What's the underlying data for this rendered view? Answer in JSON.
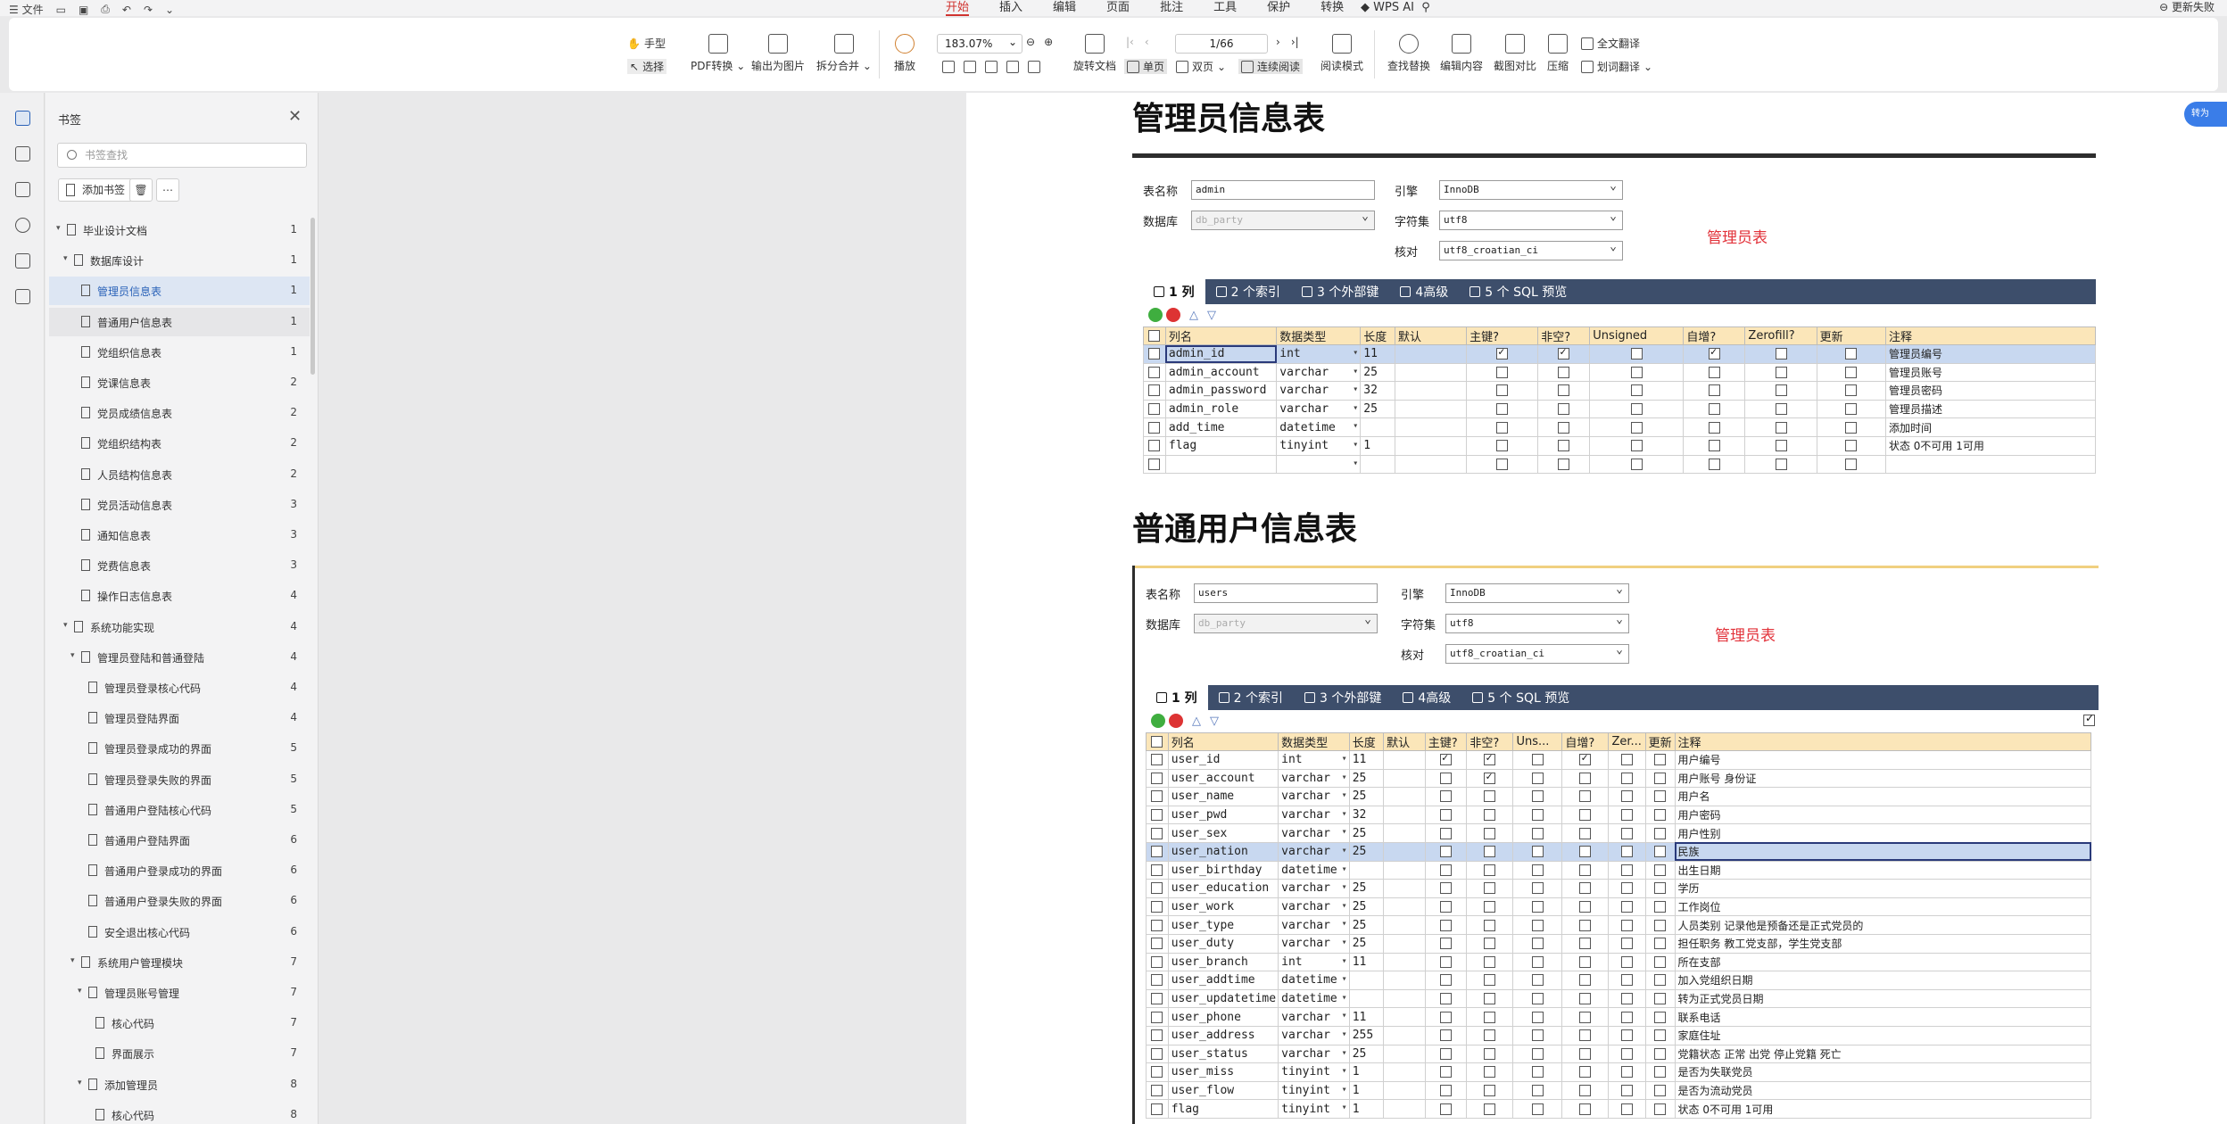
{
  "menubar": {
    "file": "文件",
    "tabs": [
      "开始",
      "插入",
      "编辑",
      "页面",
      "批注",
      "工具",
      "保护",
      "转换"
    ],
    "active_tab": 0,
    "wps_ai": "WPS AI",
    "update": "更新失败"
  },
  "toolbar": {
    "hand": "手型",
    "select": "选择",
    "pdf_convert": "PDF转换",
    "export_image": "输出为图片",
    "split_merge": "拆分合并",
    "play": "播放",
    "zoom": "183.07%",
    "rotate": "旋转文档",
    "single": "单页",
    "double": "双页",
    "continuous": "连续阅读",
    "page": "1/66",
    "read_mode": "阅读模式",
    "find_replace": "查找替换",
    "edit_content": "编辑内容",
    "screenshot_compare": "截图对比",
    "compress": "压缩",
    "full_translate": "全文翻译",
    "word_translate": "划词翻译"
  },
  "panel": {
    "title": "书签",
    "search_placeholder": "书签查找",
    "add_bookmark": "添加书签",
    "items": [
      {
        "label": "毕业设计文档",
        "page": "1",
        "level": 0,
        "arrow": true
      },
      {
        "label": "数据库设计",
        "page": "1",
        "level": 1,
        "arrow": true
      },
      {
        "label": "管理员信息表",
        "page": "1",
        "level": 2,
        "arrow": false,
        "selected": true
      },
      {
        "label": "普通用户信息表",
        "page": "1",
        "level": 2,
        "arrow": false,
        "hover": true
      },
      {
        "label": "党组织信息表",
        "page": "1",
        "level": 2,
        "arrow": false
      },
      {
        "label": "党课信息表",
        "page": "2",
        "level": 2,
        "arrow": false
      },
      {
        "label": "党员成绩信息表",
        "page": "2",
        "level": 2,
        "arrow": false
      },
      {
        "label": "党组织结构表",
        "page": "2",
        "level": 2,
        "arrow": false
      },
      {
        "label": "人员结构信息表",
        "page": "2",
        "level": 2,
        "arrow": false
      },
      {
        "label": "党员活动信息表",
        "page": "3",
        "level": 2,
        "arrow": false
      },
      {
        "label": "通知信息表",
        "page": "3",
        "level": 2,
        "arrow": false
      },
      {
        "label": "党费信息表",
        "page": "3",
        "level": 2,
        "arrow": false
      },
      {
        "label": "操作日志信息表",
        "page": "4",
        "level": 2,
        "arrow": false
      },
      {
        "label": "系统功能实现",
        "page": "4",
        "level": 1,
        "arrow": true
      },
      {
        "label": "管理员登陆和普通登陆",
        "page": "4",
        "level": 2,
        "arrow": true
      },
      {
        "label": "管理员登录核心代码",
        "page": "4",
        "level": 3,
        "arrow": false
      },
      {
        "label": "管理员登陆界面",
        "page": "4",
        "level": 3,
        "arrow": false
      },
      {
        "label": "管理员登录成功的界面",
        "page": "5",
        "level": 3,
        "arrow": false
      },
      {
        "label": "管理员登录失败的界面",
        "page": "5",
        "level": 3,
        "arrow": false
      },
      {
        "label": "普通用户登陆核心代码",
        "page": "5",
        "level": 3,
        "arrow": false
      },
      {
        "label": "普通用户登陆界面",
        "page": "6",
        "level": 3,
        "arrow": false
      },
      {
        "label": "普通用户登录成功的界面",
        "page": "6",
        "level": 3,
        "arrow": false
      },
      {
        "label": "普通用户登录失败的界面",
        "page": "6",
        "level": 3,
        "arrow": false
      },
      {
        "label": "安全退出核心代码",
        "page": "6",
        "level": 3,
        "arrow": false
      },
      {
        "label": "系统用户管理模块",
        "page": "7",
        "level": 2,
        "arrow": true
      },
      {
        "label": "管理员账号管理",
        "page": "7",
        "level": 3,
        "arrow": true
      },
      {
        "label": "核心代码",
        "page": "7",
        "level": 4,
        "arrow": false
      },
      {
        "label": "界面展示",
        "page": "7",
        "level": 4,
        "arrow": false
      },
      {
        "label": "添加管理员",
        "page": "8",
        "level": 3,
        "arrow": true
      },
      {
        "label": "核心代码",
        "page": "8",
        "level": 4,
        "arrow": false
      }
    ]
  },
  "doc": {
    "heading1": "管理员信息表",
    "heading2": "普通用户信息表",
    "labels": {
      "table_name": "表名称",
      "database": "数据库",
      "engine": "引擎",
      "charset": "字符集",
      "collation": "核对"
    },
    "tabs": [
      "1 列",
      "2 个索引",
      "3 个外部键",
      "4高级",
      "5 个 SQL 预览"
    ],
    "admin": {
      "table_name": "admin",
      "database": "db_party",
      "engine": "InnoDB",
      "charset": "utf8",
      "collation": "utf8_croatian_ci",
      "red_label": "管理员表",
      "headers": [
        "列名",
        "数据类型",
        "长度",
        "默认",
        "主键?",
        "非空?",
        "Unsigned",
        "自增?",
        "Zerofill?",
        "更新",
        "注释"
      ],
      "rows": [
        {
          "name": "admin_id",
          "type": "int",
          "len": "11",
          "pk": true,
          "nn": true,
          "ai": true,
          "comment": "管理员编号",
          "hl": true
        },
        {
          "name": "admin_account",
          "type": "varchar",
          "len": "25",
          "pk": false,
          "nn": false,
          "ai": false,
          "comment": "管理员账号"
        },
        {
          "name": "admin_password",
          "type": "varchar",
          "len": "32",
          "pk": false,
          "nn": false,
          "ai": false,
          "comment": "管理员密码"
        },
        {
          "name": "admin_role",
          "type": "varchar",
          "len": "25",
          "pk": false,
          "nn": false,
          "ai": false,
          "comment": "管理员描述"
        },
        {
          "name": "add_time",
          "type": "datetime",
          "len": "",
          "pk": false,
          "nn": false,
          "ai": false,
          "comment": "添加时间"
        },
        {
          "name": "flag",
          "type": "tinyint",
          "len": "1",
          "pk": false,
          "nn": false,
          "ai": false,
          "comment": "状态 0不可用 1可用"
        },
        {
          "name": "",
          "type": "",
          "len": "",
          "pk": false,
          "nn": false,
          "ai": false,
          "comment": ""
        }
      ]
    },
    "users": {
      "table_name": "users",
      "database": "db_party",
      "engine": "InnoDB",
      "charset": "utf8",
      "collation": "utf8_croatian_ci",
      "red_label": "管理员表",
      "headers": [
        "列名",
        "数据类型",
        "长度",
        "默认",
        "主键?",
        "非空?",
        "Uns...",
        "自增?",
        "Zer...",
        "更新",
        "注释"
      ],
      "rows": [
        {
          "name": "user_id",
          "type": "int",
          "len": "11",
          "pk": true,
          "nn": true,
          "ai": true,
          "comment": "用户编号"
        },
        {
          "name": "user_account",
          "type": "varchar",
          "len": "25",
          "pk": false,
          "nn": true,
          "ai": false,
          "comment": "用户账号 身份证"
        },
        {
          "name": "user_name",
          "type": "varchar",
          "len": "25",
          "pk": false,
          "nn": false,
          "ai": false,
          "comment": "用户名"
        },
        {
          "name": "user_pwd",
          "type": "varchar",
          "len": "32",
          "pk": false,
          "nn": false,
          "ai": false,
          "comment": "用户密码"
        },
        {
          "name": "user_sex",
          "type": "varchar",
          "len": "25",
          "pk": false,
          "nn": false,
          "ai": false,
          "comment": "用户性别"
        },
        {
          "name": "user_nation",
          "type": "varchar",
          "len": "25",
          "pk": false,
          "nn": false,
          "ai": false,
          "comment": "民族",
          "hl": true
        },
        {
          "name": "user_birthday",
          "type": "datetime",
          "len": "",
          "pk": false,
          "nn": false,
          "ai": false,
          "comment": "出生日期"
        },
        {
          "name": "user_education",
          "type": "varchar",
          "len": "25",
          "pk": false,
          "nn": false,
          "ai": false,
          "comment": "学历"
        },
        {
          "name": "user_work",
          "type": "varchar",
          "len": "25",
          "pk": false,
          "nn": false,
          "ai": false,
          "comment": "工作岗位"
        },
        {
          "name": "user_type",
          "type": "varchar",
          "len": "25",
          "pk": false,
          "nn": false,
          "ai": false,
          "comment": "人员类别 记录他是预备还是正式党员的"
        },
        {
          "name": "user_duty",
          "type": "varchar",
          "len": "25",
          "pk": false,
          "nn": false,
          "ai": false,
          "comment": "担任职务 教工党支部，学生党支部"
        },
        {
          "name": "user_branch",
          "type": "int",
          "len": "11",
          "pk": false,
          "nn": false,
          "ai": false,
          "comment": "所在支部"
        },
        {
          "name": "user_addtime",
          "type": "datetime",
          "len": "",
          "pk": false,
          "nn": false,
          "ai": false,
          "comment": "加入党组织日期"
        },
        {
          "name": "user_updatetime",
          "type": "datetime",
          "len": "",
          "pk": false,
          "nn": false,
          "ai": false,
          "comment": "转为正式党员日期"
        },
        {
          "name": "user_phone",
          "type": "varchar",
          "len": "11",
          "pk": false,
          "nn": false,
          "ai": false,
          "comment": "联系电话"
        },
        {
          "name": "user_address",
          "type": "varchar",
          "len": "255",
          "pk": false,
          "nn": false,
          "ai": false,
          "comment": "家庭住址"
        },
        {
          "name": "user_status",
          "type": "varchar",
          "len": "25",
          "pk": false,
          "nn": false,
          "ai": false,
          "comment": "党籍状态 正常 出党 停止党籍 死亡"
        },
        {
          "name": "user_miss",
          "type": "tinyint",
          "len": "1",
          "pk": false,
          "nn": false,
          "ai": false,
          "comment": "是否为失联党员"
        },
        {
          "name": "user_flow",
          "type": "tinyint",
          "len": "1",
          "pk": false,
          "nn": false,
          "ai": false,
          "comment": "是否为流动党员"
        },
        {
          "name": "flag",
          "type": "tinyint",
          "len": "1",
          "pk": false,
          "nn": false,
          "ai": false,
          "comment": "状态 0不可用 1可用"
        }
      ]
    }
  },
  "float_button": "转为",
  "colors": {
    "accent": "#d0332f",
    "tab_header": "#3d4e6b",
    "grid_header": "#fbe6b9",
    "highlight": "#c8d8f0",
    "red_label": "#e2323a"
  }
}
